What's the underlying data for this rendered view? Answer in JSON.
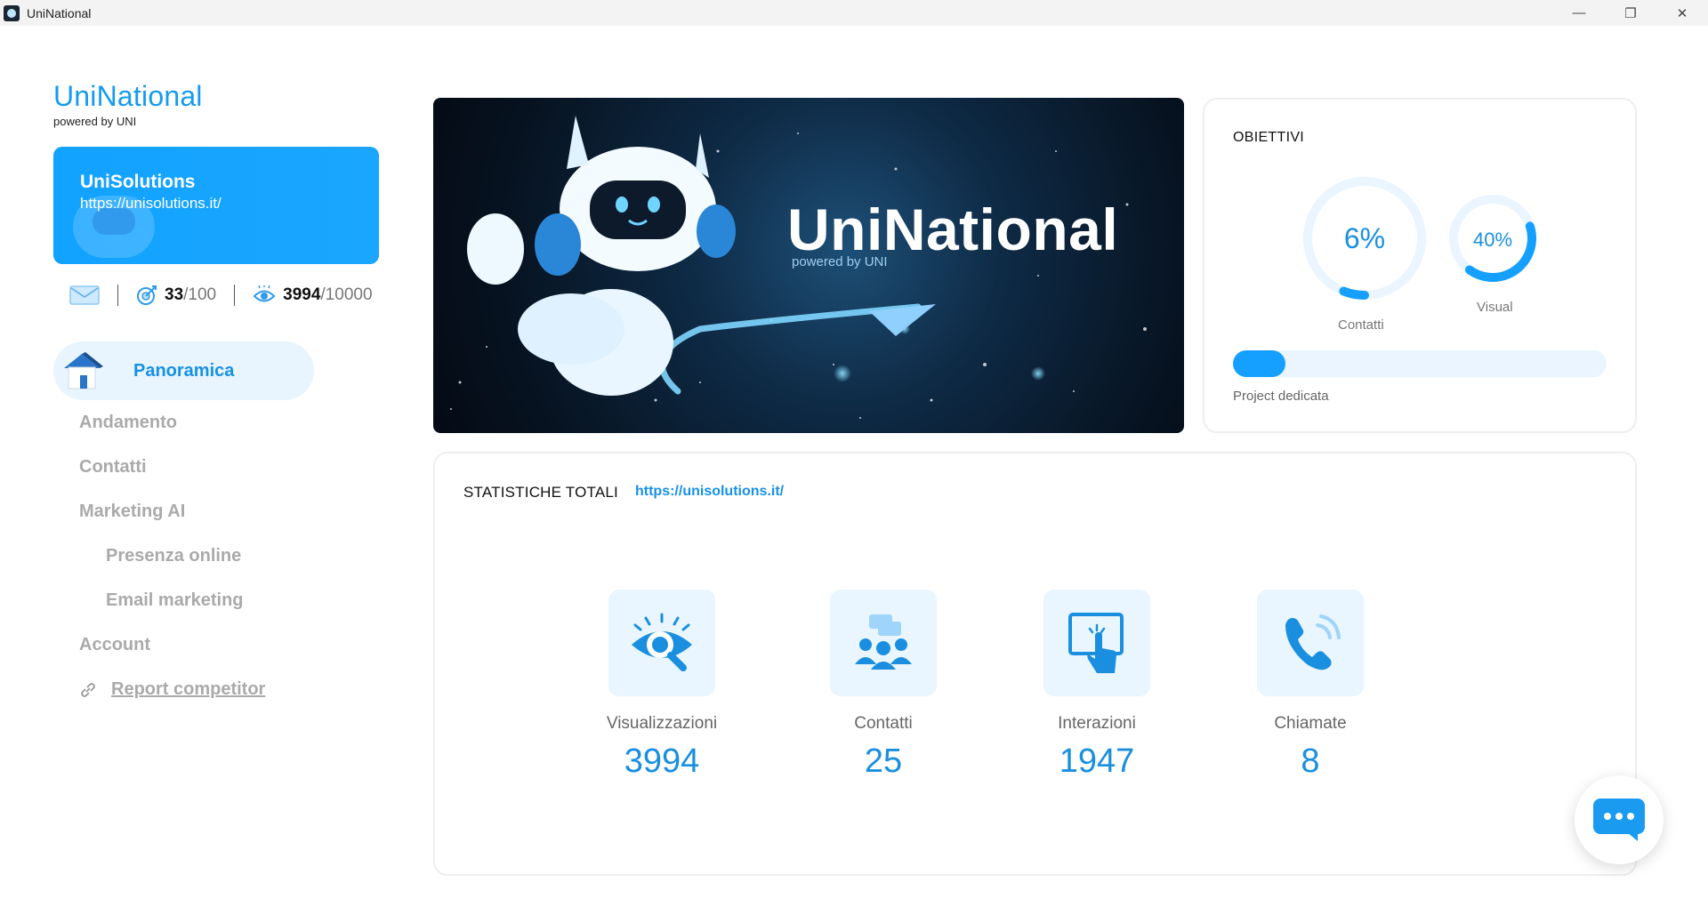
{
  "window": {
    "title": "UniNational",
    "controls": {
      "minimize": "—",
      "restore": "❐",
      "close": "✕"
    }
  },
  "brand": {
    "name": "UniNational",
    "subtitle": "powered by UNI"
  },
  "site_card": {
    "title": "UniSolutions",
    "url": "https://unisolutions.it/"
  },
  "quick_stats": {
    "icons": [
      "mail-icon",
      "target-icon",
      "eye-icon"
    ],
    "contacts_value": "33",
    "contacts_max": "/100",
    "views_value": "3994",
    "views_max": "/10000"
  },
  "nav": {
    "active": "Panoramica",
    "items": [
      "Andamento",
      "Contatti",
      "Marketing AI",
      "Presenza online",
      "Email marketing",
      "Account"
    ],
    "link": "Report competitor"
  },
  "hero": {
    "title": "UniNational",
    "subtitle": "powered by UNI"
  },
  "goals": {
    "title": "OBIETTIVI",
    "gauges": [
      {
        "label": "Contatti",
        "value_text": "6%",
        "fraction": 0.06
      },
      {
        "label": "Visual",
        "value_text": "40%",
        "fraction": 0.4
      }
    ],
    "progress": {
      "label": "Project dedicata",
      "fraction": 0.14
    },
    "colors": {
      "accent": "#15a0ff",
      "track": "#eaf5ff"
    }
  },
  "totals": {
    "title": "STATISTICHE TOTALI",
    "link": "https://unisolutions.it/",
    "metrics": [
      {
        "icon": "eye-search-icon",
        "label": "Visualizzazioni",
        "value": "3994"
      },
      {
        "icon": "people-chat-icon",
        "label": "Contatti",
        "value": "25"
      },
      {
        "icon": "touch-screen-icon",
        "label": "Interazioni",
        "value": "1947"
      },
      {
        "icon": "phone-icon",
        "label": "Chiamate",
        "value": "8"
      }
    ]
  },
  "chat": {
    "icon": "chat-bubble-icon"
  }
}
